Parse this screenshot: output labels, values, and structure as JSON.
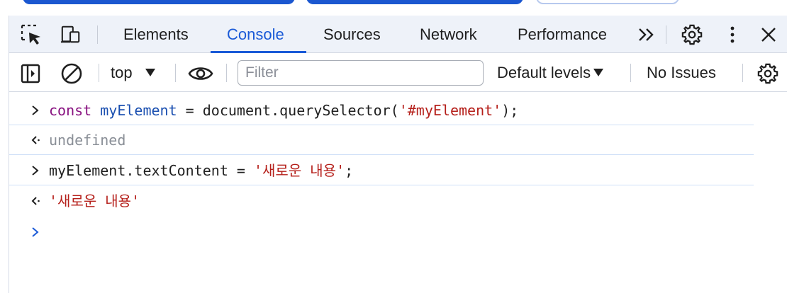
{
  "tabs": [
    {
      "label": "Elements"
    },
    {
      "label": "Console"
    },
    {
      "label": "Sources"
    },
    {
      "label": "Network"
    },
    {
      "label": "Performance"
    }
  ],
  "toolbar": {
    "context": "top",
    "filter_placeholder": "Filter",
    "levels": "Default levels",
    "issues": "No Issues"
  },
  "console": {
    "line1": {
      "keyword": "const",
      "variable": "myElement",
      "middle": " = document.querySelector(",
      "string": "'#myElement'",
      "end": ");"
    },
    "result1": "undefined",
    "line2": {
      "pre": "myElement.textContent = ",
      "string": "'새로운 내용'",
      "end": ";"
    },
    "result2": "'새로운 내용'"
  },
  "colors": {
    "accent": "#1a5ad7",
    "keyword": "#881280",
    "string": "#b51f1a",
    "variable": "#1a4fb0",
    "muted": "#8a8f97"
  },
  "icons": [
    "inspect-element-icon",
    "device-toolbar-icon",
    "more-tabs-icon",
    "settings-icon",
    "kebab-menu-icon",
    "close-icon",
    "sidebar-toggle-icon",
    "clear-console-icon",
    "dropdown-triangle-icon",
    "eye-icon",
    "console-settings-icon",
    "prompt-icon",
    "result-arrow-icon"
  ]
}
